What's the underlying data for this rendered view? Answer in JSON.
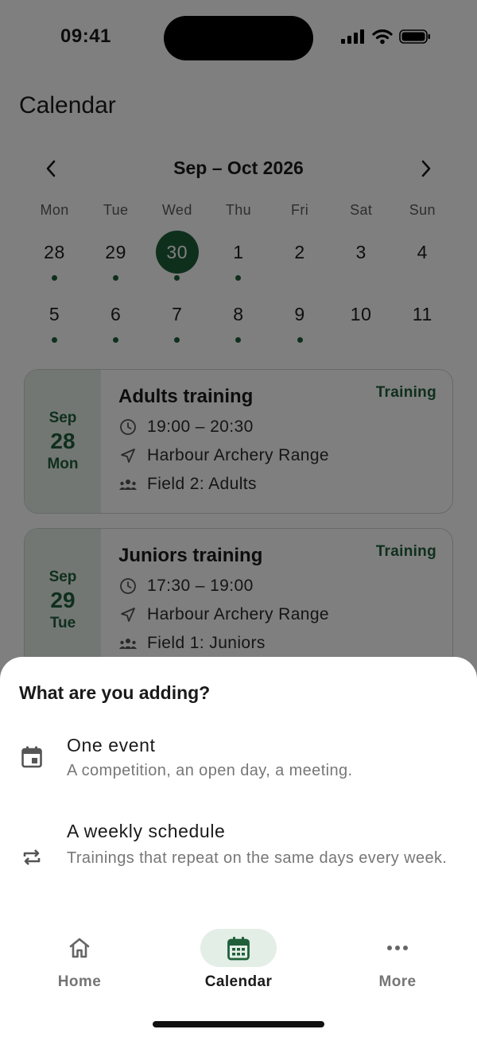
{
  "status_bar": {
    "time": "09:41"
  },
  "screen": {
    "title": "Calendar",
    "month_label": "Sep – Oct 2026",
    "weekdays": [
      "Mon",
      "Tue",
      "Wed",
      "Thu",
      "Fri",
      "Sat",
      "Sun"
    ],
    "weeks": [
      [
        {
          "label": "28",
          "dot": true,
          "selected": false
        },
        {
          "label": "29",
          "dot": true,
          "selected": false
        },
        {
          "label": "30",
          "dot": true,
          "selected": true
        },
        {
          "label": "1",
          "dot": true,
          "selected": false
        },
        {
          "label": "2",
          "dot": false,
          "selected": false
        },
        {
          "label": "3",
          "dot": false,
          "selected": false
        },
        {
          "label": "4",
          "dot": false,
          "selected": false
        }
      ],
      [
        {
          "label": "5",
          "dot": true,
          "selected": false
        },
        {
          "label": "6",
          "dot": true,
          "selected": false
        },
        {
          "label": "7",
          "dot": true,
          "selected": false
        },
        {
          "label": "8",
          "dot": true,
          "selected": false
        },
        {
          "label": "9",
          "dot": true,
          "selected": false
        },
        {
          "label": "10",
          "dot": false,
          "selected": false
        },
        {
          "label": "11",
          "dot": false,
          "selected": false
        }
      ]
    ],
    "events": [
      {
        "month": "Sep",
        "day": "28",
        "weekday": "Mon",
        "title": "Adults training",
        "tag": "Training",
        "time": "19:00 – 20:30",
        "location": "Harbour Archery Range",
        "group": "Field 2: Adults"
      },
      {
        "month": "Sep",
        "day": "29",
        "weekday": "Tue",
        "title": "Juniors training",
        "tag": "Training",
        "time": "17:30 – 19:00",
        "location": "Harbour Archery Range",
        "group": "Field 1: Juniors"
      }
    ]
  },
  "sheet": {
    "title": "What are you adding?",
    "options": [
      {
        "icon": "calendar-event-icon",
        "title": "One event",
        "description": "A competition, an open day, a meeting."
      },
      {
        "icon": "repeat-icon",
        "title": "A weekly schedule",
        "description": "Trainings that repeat on the same days every week."
      }
    ]
  },
  "nav": {
    "items": [
      {
        "icon": "home-icon",
        "label": "Home",
        "active": false
      },
      {
        "icon": "calendar-icon",
        "label": "Calendar",
        "active": true
      },
      {
        "icon": "more-icon",
        "label": "More",
        "active": false
      }
    ]
  },
  "colors": {
    "accent": "#1f5f3a",
    "accent_light": "#e3eee7",
    "overlay": "rgba(0,0,0,0.5)"
  }
}
